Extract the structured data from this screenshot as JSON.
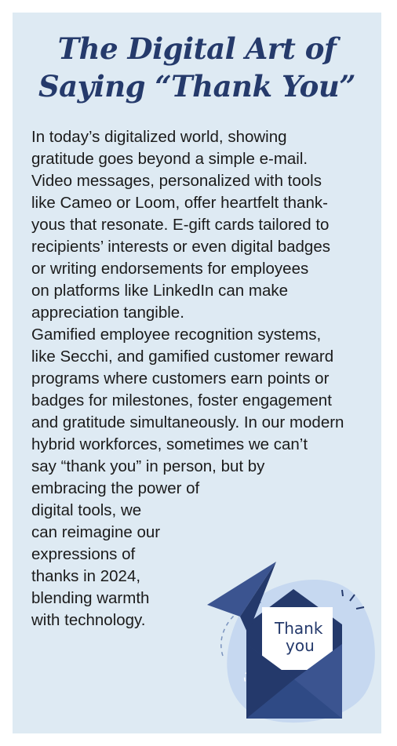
{
  "heading": {
    "line1": "The Digital Art of",
    "line2": "Saying “Thank You”"
  },
  "paragraph1": [
    "In today’s digitalized world, showing",
    "gratitude goes beyond a simple e-mail.",
    "Video messages, personalized with tools",
    "like Cameo or Loom, offer heartfelt thank-",
    "yous that resonate. E-gift cards tailored to",
    "recipients’ interests or even digital badges",
    "or writing endorsements for employees",
    "on platforms like LinkedIn can make",
    "appreciation tangible."
  ],
  "paragraph2": [
    "Gamified employee recognition systems,",
    "like Secchi, and gamified customer reward",
    "programs where customers earn points or",
    "badges for milestones, foster engagement",
    "and gratitude simultaneously. In our modern",
    "hybrid workforces, sometimes we can’t",
    "say “thank you” in person, but by",
    "embracing the power of",
    "digital tools, we",
    "can reimagine our",
    "expressions of",
    "thanks in 2024,",
    "blending warmth",
    "with technology."
  ],
  "illustration": {
    "icon": "thank-you-envelope-icon",
    "card_text_line1": "Thank",
    "card_text_line2": "you",
    "colors": {
      "panel_background": "#deeaf3",
      "heading": "#253a6b",
      "envelope_dark": "#24396b",
      "envelope_mid": "#3b5490",
      "blob": "#c6d8f0"
    }
  }
}
